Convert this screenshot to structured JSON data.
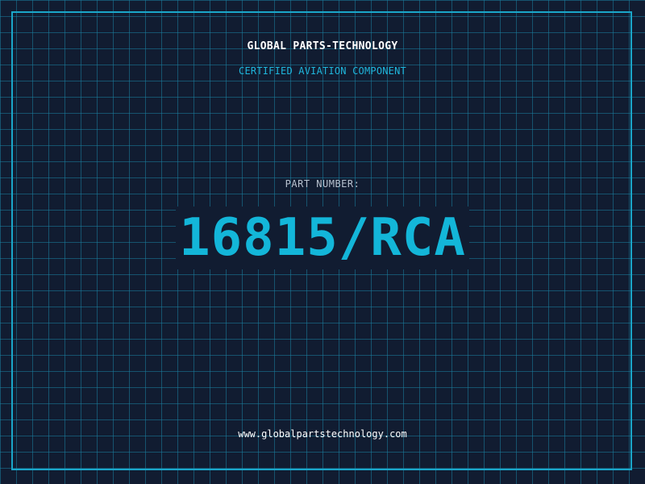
{
  "header": {
    "company_name": "GLOBAL PARTS-TECHNOLOGY",
    "tagline": "CERTIFIED AVIATION COMPONENT"
  },
  "part": {
    "label": "PART NUMBER:",
    "number": "16815/RCA"
  },
  "footer": {
    "website": "www.globalpartstechnology.com"
  },
  "colors": {
    "background": "#111c31",
    "grid": "#1a7fa0",
    "accent": "#13b6d9",
    "label": "#b8c2cf",
    "text": "#ffffff"
  }
}
